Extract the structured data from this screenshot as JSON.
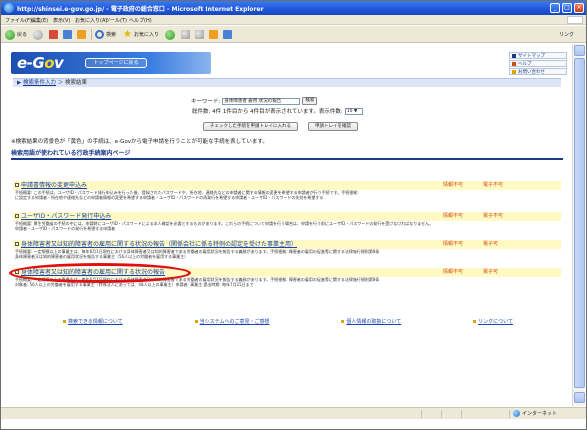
{
  "window": {
    "title": "http://shinsei.e-gov.go.jp/ - 電子政府の総合窓口 - Microsoft Internet Explorer",
    "min_label": "_",
    "max_label": "□",
    "close_label": "×"
  },
  "menu": {
    "items": [
      "ファイル(F)",
      "編集(E)",
      "表示(V)",
      "お気に入り(A)",
      "ツール(T)",
      "ヘルプ(H)"
    ]
  },
  "toolbar": {
    "back_label": "戻る",
    "search_label": "検索",
    "favorites_label": "お気に入り",
    "links_label": "リンク"
  },
  "header": {
    "logo_text_e": "e-G",
    "logo_text_o": "o",
    "logo_text_v": "v",
    "top_link": "トップページに戻る",
    "side_links": [
      "サイトマップ",
      "ヘルプ",
      "お問い合わせ"
    ]
  },
  "breadcrumb": {
    "link": "検索条件入力",
    "sep": " ＞ ",
    "current": "検索結果"
  },
  "search": {
    "keyword_label": "キーワード:",
    "keyword_value": "身体障害者 雇用 状況の報告",
    "keyword_button": "検索",
    "count_text": "総件数: 4件 1件目から 4件目が表示されています。表示件数:",
    "per_page_value": "10"
  },
  "buttons": {
    "add_to_tray": "チェックした手続を申請トレイに入れる",
    "check_tray": "申請トレイを確認"
  },
  "note": "※検索結果の背景色が「黄色」の手続は、e-Govから電子申請を行うことが可能な手続を表しています。",
  "section_title": "検索用語が使われている行政手続案内ページ",
  "results": [
    {
      "title": "申請書情報の変更申込み",
      "tag1": "情報不可",
      "tag2": "電子不可",
      "desc1": "手続概要: この手続は、ユーザID・パスワード発行申込みを行った後、登録されたパスワードや、所在地、連絡先などの申請者に関する情報の変更を希望する申請者が行う手続です。手続根拠: ",
      "desc2": "に設定する申請者・所在地や連絡先などの申請者情報の変更を希望する申請者・ユーザID・パスワードの再発行を希望する申請者・ユーザID・パスワードの失効を希望する"
    },
    {
      "title": "ユーザID・パスワード発行申込み",
      "tag1": "情報不可",
      "tag2": "電子不可",
      "desc1": "手続概要: 厚生労働省の手続の中には、申請時にユーザID・パスワードによる本人確認を必要とするものがあります。これらの手続について申請を行う場合は、申請を行う前にユーザID・パスワードの発行を受けなければなりません。",
      "desc2": "申請者・ユーザID・パスワードの発行を希望する申請者"
    },
    {
      "title": "身体障害者又は知的障害者の雇用に関する状況の報告（関係会社に係る特例の認定を受けた事業主用）",
      "tag1": "情報不可",
      "tag2": "電子可",
      "desc1": "手続概要: 一定規模以上の事業主は、毎年6月1日現在における身体障害者又は知的障害者である労働者の雇用状況を報告する義務があります。手続根拠: 障害者の雇用の促進等に関する法律施行規則第8条",
      "desc2": "身体障害者又は知的障害者の雇用状況を報告する事業主（56人以上の労働者を雇用する事業主）"
    },
    {
      "title": "身体障害者又は知的障害者の雇用に関する状況の報告",
      "tag1": "情報不可",
      "tag2": "電子可",
      "desc1": "手続概要: 一定規模以上の事業主は、毎年6月1日現在における身体障害者又は知的障害者である労働者の雇用状況を報告する義務があります。手続根拠: 障害者の雇用の促進等に関する法律施行規則第8条",
      "desc2": "対象者: 56人以上の労働者を雇用する事業主（特殊法人にあっては、48人以上の事業主）申請者: 事業主 提出時期: 毎年7月15日まで"
    }
  ],
  "footer": {
    "links": [
      "検索できる情報について",
      "当システムへのご意見・ご感想",
      "個人情報の取扱について",
      "リンクについて"
    ]
  },
  "status": {
    "zone": "インターネット"
  },
  "colors": {
    "accent": "#1b3b8a",
    "highlight_yellow": "#fff9c4",
    "oval_red": "#e01010"
  }
}
